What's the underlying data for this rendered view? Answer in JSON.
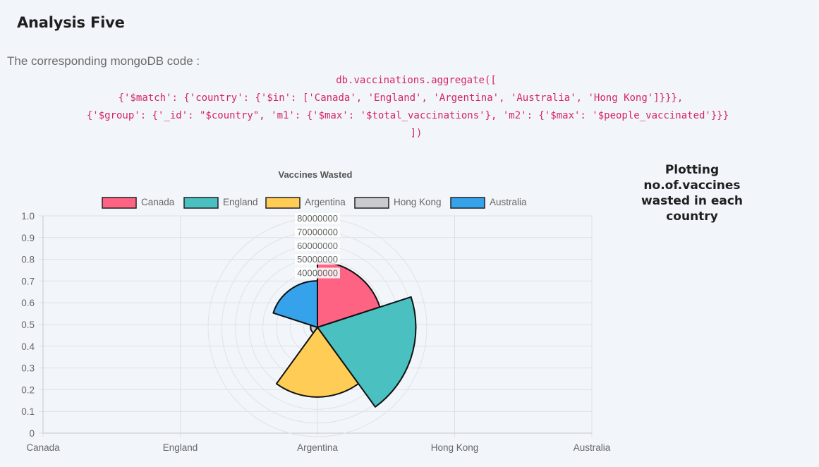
{
  "page": {
    "heading": "Analysis Five",
    "intro": "The corresponding mongoDB code :",
    "code_lines": [
      "db.vaccinations.aggregate([",
      "{'$match': {'country': {'$in': ['Canada', 'England', 'Argentina', 'Australia', 'Hong Kong']}}},",
      "{'$group': {'_id': \"$country\", 'm1': {'$max': '$total_vaccinations'}, 'm2': {'$max': '$people_vaccinated'}}}",
      "])"
    ],
    "side_title": "Plotting no.of.vaccines wasted in each country"
  },
  "chart_data": {
    "type": "polarArea",
    "title": "Vaccines Wasted",
    "categories": [
      "Canada",
      "England",
      "Argentina",
      "Hong Kong",
      "Australia"
    ],
    "values": [
      48000000,
      72000000,
      51000000,
      5000000,
      34000000
    ],
    "colors": [
      "#ff6384",
      "#4bc0c0",
      "#ffcd56",
      "#c9cbcf",
      "#36a2eb"
    ],
    "r_ticks": [
      "80000000",
      "70000000",
      "60000000",
      "50000000",
      "40000000"
    ],
    "r_max": 80000000,
    "y_ticks": [
      "1.0",
      "0.9",
      "0.8",
      "0.7",
      "0.6",
      "0.5",
      "0.4",
      "0.3",
      "0.2",
      "0.1",
      "0"
    ],
    "x_ticks": [
      "Canada",
      "England",
      "Argentina",
      "Hong Kong",
      "Australia"
    ],
    "legend_position": "top"
  }
}
